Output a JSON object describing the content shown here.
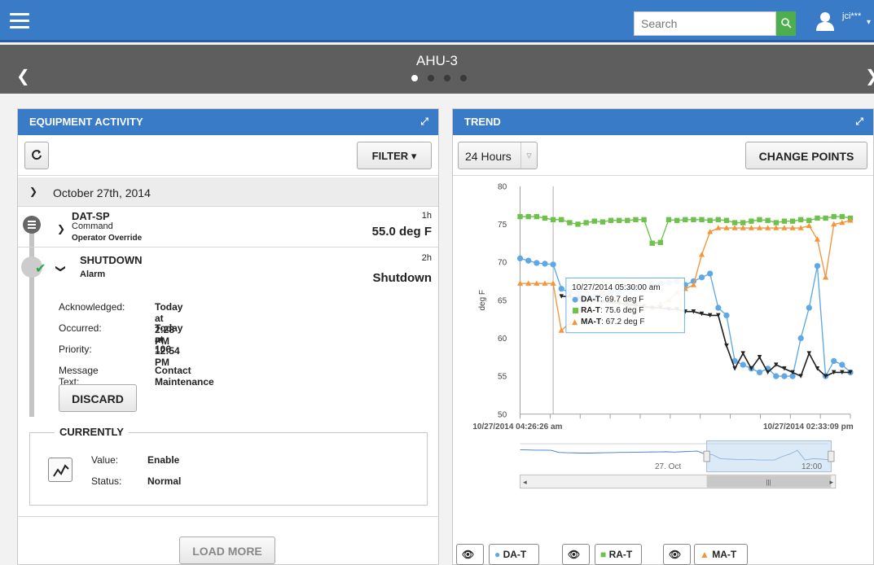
{
  "topbar": {
    "search_placeholder": "Search",
    "search_icon": "search-icon",
    "user_name": "jci***",
    "accent": "#3a7bc8"
  },
  "titlebar": {
    "title": "AHU-3",
    "page_count": 4,
    "active_page": 1
  },
  "activity": {
    "title": "EQUIPMENT ACTIVITY",
    "filter_label": "FILTER",
    "date_header": "October 27th, 2014",
    "events": [
      {
        "title": "DAT-SP",
        "type": "Command",
        "source": "Operator Override",
        "age": "1h",
        "value": "55.0 deg F"
      },
      {
        "title": "SHUTDOWN",
        "type": "Alarm",
        "age": "2h",
        "value": "Shutdown"
      }
    ],
    "details": [
      {
        "key": "Acknowledged:",
        "value": "Today at 2:28 PM"
      },
      {
        "key": "Occurred:",
        "value": "Today at 12:54 PM"
      },
      {
        "key": "Priority:",
        "value": "106"
      },
      {
        "key": "Message Text:",
        "value": "Contact Maintenance"
      }
    ],
    "discard_label": "DISCARD",
    "currently": {
      "label": "CURRENTLY",
      "value_key": "Value:",
      "value": "Enable",
      "status_key": "Status:",
      "status": "Normal"
    },
    "load_more_label": "LOAD MORE"
  },
  "trend": {
    "title": "TREND",
    "range_label": "24 Hours",
    "change_points_label": "CHANGE POINTS",
    "navigator_label": "27. Oct",
    "navigator_label2": "12:00",
    "tooltip": {
      "time": "10/27/2014 05:30:00 am",
      "lines": [
        {
          "name": "DA-T",
          "value": ": 69.7 deg F"
        },
        {
          "name": "RA-T",
          "value": ": 75.6 deg F"
        },
        {
          "name": "MA-T",
          "value": ": 67.2 deg F"
        }
      ]
    },
    "legend": [
      {
        "name": "DA-T",
        "color": "#5fa8e6"
      },
      {
        "name": "RA-T",
        "color": "#6cc24a"
      },
      {
        "name": "MA-T",
        "color": "#f5953a"
      }
    ]
  },
  "chart_data": {
    "type": "line",
    "ylabel": "deg F",
    "ylim": [
      50,
      80
    ],
    "yticks": [
      50,
      55,
      60,
      65,
      70,
      75,
      80
    ],
    "x_start_label": "10/27/2014 04:26:26 am",
    "x_end_label": "10/27/2014 02:33:09 pm",
    "x": [
      0,
      1,
      2,
      3,
      4,
      5,
      6,
      7,
      8,
      9,
      10,
      11,
      12,
      13,
      14,
      15,
      16,
      17,
      18,
      19,
      20,
      21,
      22,
      23,
      24,
      25,
      26,
      27,
      28,
      29,
      30,
      31,
      32,
      33,
      34,
      35,
      36,
      37,
      38,
      39,
      40
    ],
    "series": [
      {
        "name": "DA-T",
        "color": "#5fa8e6",
        "marker": "circle",
        "values": [
          70.5,
          70.2,
          69.9,
          69.8,
          69.7,
          66.5,
          66.0,
          65.8,
          65.5,
          65.5,
          65.8,
          66.0,
          66.2,
          66.5,
          66.5,
          66.8,
          67.0,
          67.2,
          67.3,
          67.5,
          67.0,
          67.5,
          68.0,
          68.5,
          64.0,
          63.0,
          57.0,
          56.5,
          56.0,
          55.5,
          56.0,
          55.0,
          55.0,
          55.0,
          60.0,
          64.0,
          69.5,
          55.0,
          57.0,
          56.5,
          55.5
        ]
      },
      {
        "name": "RA-T",
        "color": "#6cc24a",
        "marker": "square",
        "values": [
          76.0,
          76.0,
          76.0,
          75.8,
          75.6,
          75.6,
          75.2,
          75.0,
          75.2,
          75.4,
          75.3,
          75.5,
          75.5,
          75.5,
          75.6,
          75.6,
          72.5,
          72.6,
          75.6,
          75.5,
          75.6,
          75.6,
          75.6,
          75.5,
          75.6,
          75.5,
          75.2,
          75.2,
          75.4,
          75.6,
          75.5,
          75.2,
          75.4,
          75.4,
          75.6,
          75.5,
          75.8,
          75.8,
          76.0,
          76.0,
          75.8
        ]
      },
      {
        "name": "MA-T",
        "color": "#f5953a",
        "marker": "triangle",
        "values": [
          67.2,
          67.2,
          67.2,
          67.2,
          67.2,
          61.0,
          62.0,
          63.5,
          64.0,
          65.0,
          66.0,
          65.5,
          65.0,
          64.5,
          64.5,
          64.0,
          64.0,
          64.5,
          65.0,
          66.0,
          66.5,
          67.0,
          71.0,
          74.0,
          74.5,
          74.5,
          74.5,
          74.5,
          74.5,
          74.5,
          74.5,
          74.5,
          74.5,
          74.5,
          74.5,
          74.8,
          73.0,
          68.0,
          75.0,
          75.2,
          75.5
        ]
      }
    ],
    "setpoint_series": {
      "name": "DAT-SP",
      "color": "#222222",
      "values": [
        null,
        null,
        null,
        null,
        null,
        65.5,
        65.5,
        65.3,
        65.0,
        65.0,
        64.8,
        64.7,
        64.6,
        64.4,
        64.3,
        64.2,
        64.0,
        64.0,
        63.8,
        63.8,
        63.5,
        63.5,
        63.2,
        63.0,
        63.0,
        59.0,
        56.0,
        58.0,
        56.0,
        57.5,
        55.5,
        56.5,
        56.0,
        55.5,
        55.0,
        58.0,
        56.0,
        55.0,
        55.5,
        55.5,
        55.5
      ]
    }
  }
}
